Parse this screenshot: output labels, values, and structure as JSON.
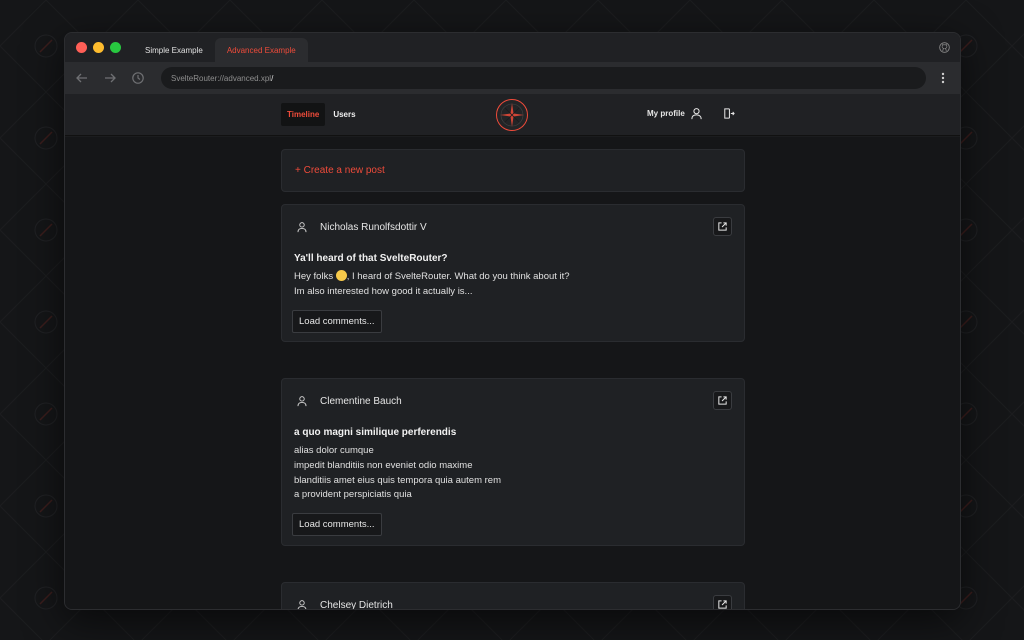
{
  "browser": {
    "tabs": [
      {
        "label": "Simple Example"
      },
      {
        "label": "Advanced Example"
      }
    ],
    "url": "SvelteRouter://advanced.xpl",
    "url_suffix": "/"
  },
  "app_nav": {
    "links": [
      {
        "label": "Timeline"
      },
      {
        "label": "Users"
      }
    ],
    "profile_label": "My profile",
    "accent_color": "#ef4b3a"
  },
  "feed": {
    "create_label": "+ Create a new post",
    "posts": [
      {
        "author": "Nicholas Runolfsdottir V",
        "title": "Ya'll heard of that SvelteRouter?",
        "body_lines": [
          "Hey folks",
          ", I heard of SvelteRouter. What do you think about it?",
          "Im also interested how good it actually is..."
        ],
        "load_label": "Load comments..."
      },
      {
        "author": "Clementine Bauch",
        "title": "a quo magni similique perferendis",
        "body_lines": [
          "alias dolor cumque",
          "impedit blanditiis non eveniet odio maxime",
          "blanditiis amet eius quis tempora quia autem rem",
          "a provident perspiciatis quia"
        ],
        "load_label": "Load comments..."
      },
      {
        "author": "Chelsey Dietrich"
      }
    ]
  }
}
